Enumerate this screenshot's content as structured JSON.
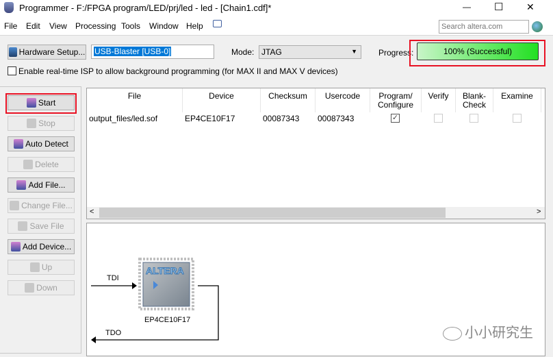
{
  "window": {
    "title": "Programmer - F:/FPGA program/LED/prj/led - led - [Chain1.cdf]*",
    "minimize": "—",
    "maximize": "☐",
    "close": "✕"
  },
  "menu": [
    "File",
    "Edit",
    "View",
    "Processing",
    "Tools",
    "Window",
    "Help"
  ],
  "search": {
    "placeholder": "Search altera.com"
  },
  "toolbar": {
    "hardware_setup": "Hardware Setup...",
    "hardware_value": "USB-Blaster [USB-0]",
    "mode_label": "Mode:",
    "mode_value": "JTAG",
    "progress_label": "Progress:",
    "progress_text": "100% (Successful)",
    "progress_percent": 100,
    "isp_label": "Enable real-time ISP to allow background programming (for MAX II and MAX V devices)",
    "isp_checked": false
  },
  "sidebar": [
    {
      "label": "Start",
      "icon": "start-icon",
      "enabled": true
    },
    {
      "label": "Stop",
      "icon": "stop-icon",
      "enabled": false
    },
    {
      "label": "Auto Detect",
      "icon": "auto-detect-icon",
      "enabled": true
    },
    {
      "label": "Delete",
      "icon": "delete-icon",
      "enabled": false
    },
    {
      "label": "Add File...",
      "icon": "add-file-icon",
      "enabled": true
    },
    {
      "label": "Change File...",
      "icon": "change-file-icon",
      "enabled": false
    },
    {
      "label": "Save File",
      "icon": "save-file-icon",
      "enabled": false
    },
    {
      "label": "Add Device...",
      "icon": "add-device-icon",
      "enabled": true
    },
    {
      "label": "Up",
      "icon": "up-icon",
      "enabled": false
    },
    {
      "label": "Down",
      "icon": "down-icon",
      "enabled": false
    }
  ],
  "table": {
    "headers": [
      "File",
      "Device",
      "Checksum",
      "Usercode",
      "Program/\nConfigure",
      "Verify",
      "Blank-\nCheck",
      "Examine"
    ],
    "rows": [
      {
        "file": "output_files/led.sof",
        "device": "EP4CE10F17",
        "checksum": "00087343",
        "usercode": "00087343",
        "program": true,
        "verify": false,
        "blank_check": false,
        "examine": false
      }
    ]
  },
  "diagram": {
    "tdi": "TDI",
    "tdo": "TDO",
    "chip_label": "EP4CE10F17",
    "chip_logo": "ALTERA"
  },
  "watermark": "小小研究生",
  "colors": {
    "highlight": "#e81123",
    "progress": "#22e022",
    "selection": "#0078d7"
  }
}
